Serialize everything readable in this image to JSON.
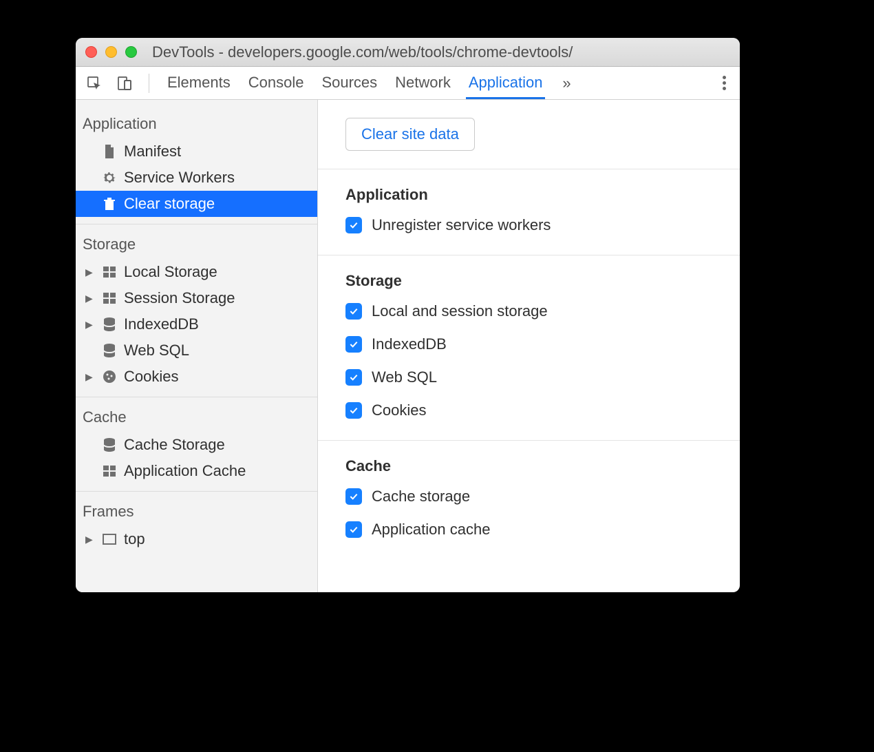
{
  "titlebar": {
    "title": "DevTools - developers.google.com/web/tools/chrome-devtools/"
  },
  "tabs": {
    "elements": "Elements",
    "console": "Console",
    "sources": "Sources",
    "network": "Network",
    "application": "Application"
  },
  "sidebar": {
    "application": {
      "header": "Application",
      "manifest": "Manifest",
      "serviceWorkers": "Service Workers",
      "clearStorage": "Clear storage"
    },
    "storage": {
      "header": "Storage",
      "localStorage": "Local Storage",
      "sessionStorage": "Session Storage",
      "indexedDB": "IndexedDB",
      "webSQL": "Web SQL",
      "cookies": "Cookies"
    },
    "cache": {
      "header": "Cache",
      "cacheStorage": "Cache Storage",
      "applicationCache": "Application Cache"
    },
    "frames": {
      "header": "Frames",
      "top": "top"
    }
  },
  "main": {
    "clearButton": "Clear site data",
    "application": {
      "header": "Application",
      "unregister": "Unregister service workers"
    },
    "storage": {
      "header": "Storage",
      "localSession": "Local and session storage",
      "indexedDB": "IndexedDB",
      "webSQL": "Web SQL",
      "cookies": "Cookies"
    },
    "cache": {
      "header": "Cache",
      "cacheStorage": "Cache storage",
      "applicationCache": "Application cache"
    }
  }
}
